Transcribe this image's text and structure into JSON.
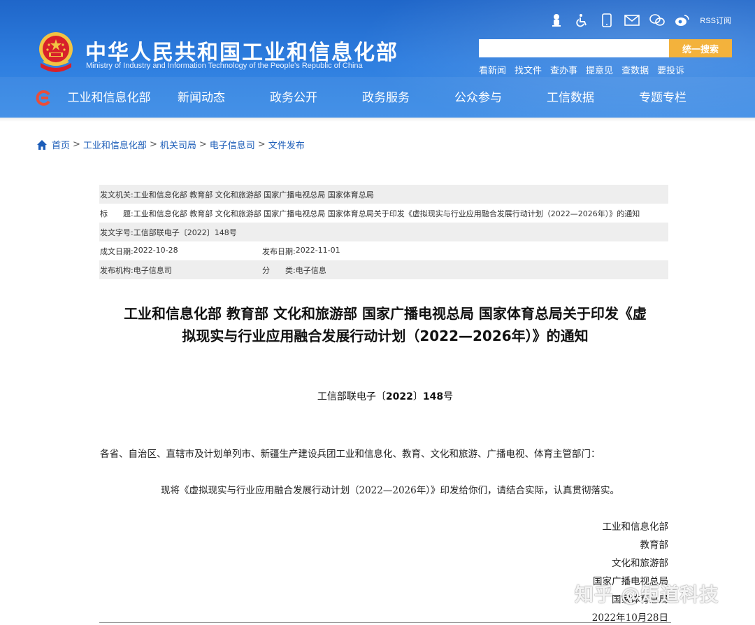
{
  "header": {
    "title": "中华人民共和国工业和信息化部",
    "subtitle": "Ministry of Industry and Information Technology of the People's Republic of China",
    "rss_label": "RSS订阅",
    "search": {
      "placeholder": "",
      "button_label": "统一搜索"
    },
    "quick_links": [
      "看新闻",
      "找文件",
      "查办事",
      "提意见",
      "查数据",
      "要投诉"
    ],
    "nav": [
      "工业和信息化部",
      "新闻动态",
      "政务公开",
      "政务服务",
      "公众参与",
      "工信数据",
      "专题专栏"
    ],
    "colors": {
      "header_bg": "#2f7fe0",
      "search_button": "#f3b23c",
      "emblem_red": "#d8202a",
      "emblem_gold": "#f2c443"
    }
  },
  "breadcrumb": [
    "首页",
    "工业和信息化部",
    "机关司局",
    "电子信息司",
    "文件发布"
  ],
  "info": {
    "issuer_label": "发文机关:",
    "issuer": "工业和信息化部 教育部 文化和旅游部 国家广播电视总局 国家体育总局",
    "title_label": "标　　题:",
    "title": "工业和信息化部 教育部 文化和旅游部 国家广播电视总局 国家体育总局关于印发《虚拟现实与行业应用融合发展行动计划（2022—2026年）》的通知",
    "doc_no_label": "发文字号:",
    "doc_no": "工信部联电子〔2022〕148号",
    "created_label": "成文日期:",
    "created": "2022-10-28",
    "published_label": "发布日期:",
    "published": "2022-11-01",
    "org_label": "发布机构:",
    "org": "电子信息司",
    "category_label": "分　　类:",
    "category": "电子信息"
  },
  "document": {
    "title_line1": "工业和信息化部 教育部 文化和旅游部 国家广播电视总局 国家体育总局关于印发《虚",
    "title_line2": "拟现实与行业应用融合发展行动计划（2022—2026年）》的通知",
    "number_prefix": "工信部联电子〔",
    "number_year": "2022",
    "number_mid": "〕",
    "number_num": "148",
    "number_suffix": "号",
    "salutation": "各省、自治区、直辖市及计划单列市、新疆生产建设兵团工业和信息化、教育、文化和旅游、广播电视、体育主管部门：",
    "paragraph": "现将《虚拟现实与行业应用融合发展行动计划（2022—2026年）》印发给你们，请结合实际，认真贯彻落实。",
    "signatories": [
      "工业和信息化部",
      "教育部",
      "文化和旅游部",
      "国家广播电视总局",
      "国家体育总局"
    ],
    "date": "2022年10月28日"
  },
  "watermark": "知乎 @矩道科技"
}
